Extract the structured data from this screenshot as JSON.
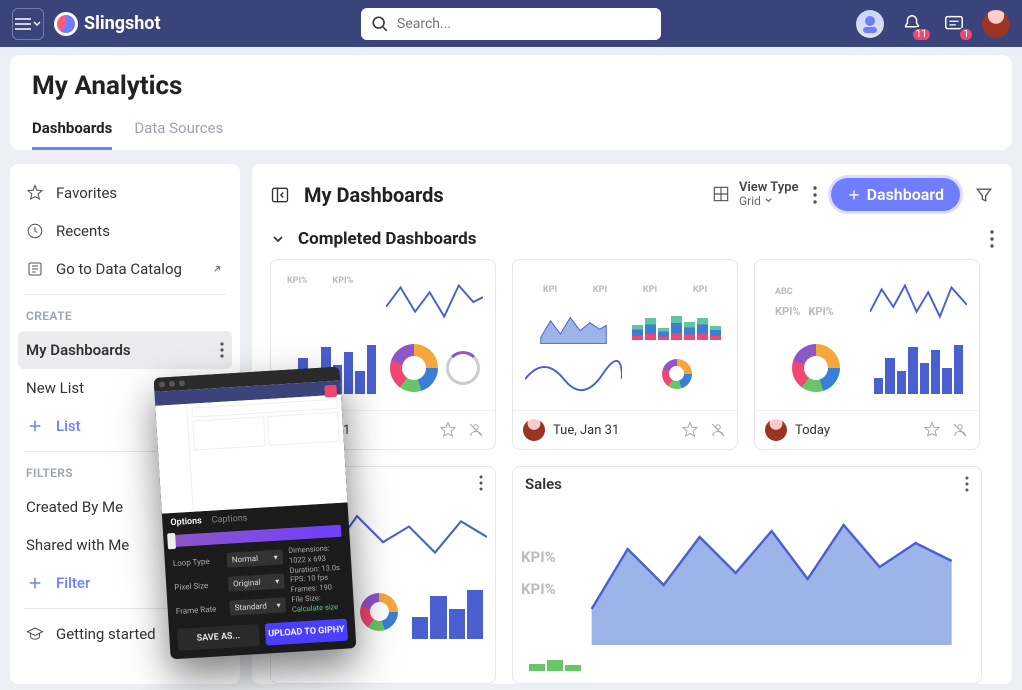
{
  "brand": "Slingshot",
  "search": {
    "placeholder": "Search..."
  },
  "topbar": {
    "notif_count": "11",
    "msg_count": "1"
  },
  "page": {
    "title": "My Analytics"
  },
  "tabs": {
    "dashboards": "Dashboards",
    "data_sources": "Data Sources"
  },
  "sidebar": {
    "favorites": "Favorites",
    "recents": "Recents",
    "catalog": "Go to Data Catalog",
    "create_head": "CREATE",
    "my_dashboards": "My Dashboards",
    "new_list": "New List",
    "list_link": "List",
    "filters_head": "FILTERS",
    "created_by_me": "Created By Me",
    "shared_with_me": "Shared with Me",
    "filter_link": "Filter",
    "getting_started": "Getting started"
  },
  "main": {
    "title": "My Dashboards",
    "view_type_label": "View Type",
    "view_type_value": "Grid",
    "new_dashboard": "Dashboard",
    "section": "Completed Dashboards"
  },
  "cards": [
    {
      "date": "Jan 31",
      "abc": ""
    },
    {
      "date": "Tue, Jan 31"
    },
    {
      "date": "Today",
      "abc": "ABC"
    }
  ],
  "kpi": "KPI%",
  "kpi_ic": "KPI",
  "row2": {
    "sales": "Sales"
  },
  "floater": {
    "tab_options": "Options",
    "tab_captions": "Captions",
    "loop_type": "Loop Type",
    "pixel_size": "Pixel Size",
    "frame_rate": "Frame Rate",
    "normal": "Normal",
    "original": "Original",
    "standard": "Standard",
    "dim_label": "Dimensions:",
    "dim": "1022 x 693",
    "dur_label": "Duration:",
    "dur": "13.0s",
    "fps_label": "FPS:",
    "fps": "10 fps",
    "frames_label": "Frames:",
    "frames": "190",
    "size_label": "File Size:",
    "size": "Calculate size",
    "save": "SAVE AS...",
    "upload": "UPLOAD TO GIPHY"
  }
}
